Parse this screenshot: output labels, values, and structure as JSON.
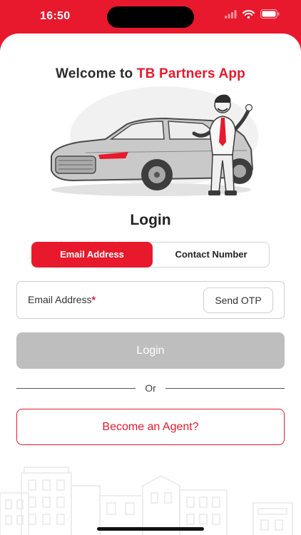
{
  "status_bar": {
    "time": "16:50",
    "icons": [
      "signal-icon",
      "wifi-icon",
      "battery-icon"
    ]
  },
  "header": {
    "welcome_prefix": "Welcome to ",
    "app_name": "TB Partners App"
  },
  "hero": {
    "illustration": "car-and-businessman-illustration"
  },
  "login": {
    "heading": "Login",
    "tabs": [
      {
        "label": "Email Address",
        "active": true
      },
      {
        "label": "Contact Number",
        "active": false
      }
    ],
    "email_label": "Email Address",
    "required_mark": "*",
    "send_otp_label": "Send OTP",
    "login_button_label": "Login",
    "or_text": "Or",
    "agent_button_label": "Become an Agent?"
  },
  "footer": {
    "illustration": "buildings-illustration"
  },
  "colors": {
    "brand": "#e8192c",
    "disabled": "#bebebe",
    "text": "#2b2b2b"
  }
}
